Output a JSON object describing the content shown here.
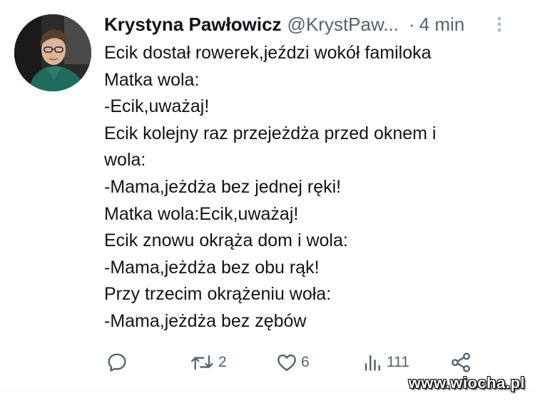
{
  "author": {
    "display_name": "Krystyna Pawłowicz",
    "handle": "@KrystPaw...",
    "separator": "·",
    "time": "4 min"
  },
  "tweet": {
    "lines": [
      "Ecik dostał rowerek,jeździ wokół familoka",
      "Matka wola:",
      "-Ecik,uważaj!",
      "Ecik kolejny raz przejeżdża przed oknem i",
      "wola:",
      "-Mama,jeżdża bez jednej ręki!",
      "Matka wola:Ecik,uważaj!",
      "Ecik znowu okrąża dom i wola:",
      "-Mama,jeżdża bez obu rąk!",
      "Przy trzecim okrążeniu woła:",
      "-Mama,jeżdża bez zębów"
    ]
  },
  "actions": {
    "reply_count": "",
    "retweet_count": "2",
    "like_count": "6",
    "views_count": "111"
  },
  "watermark": "www.wiocha.pl",
  "colors": {
    "text": "#0f1419",
    "muted": "#536471",
    "divider": "#eff3f4"
  },
  "icons": [
    "more-icon",
    "reply-icon",
    "retweet-icon",
    "like-icon",
    "views-icon",
    "share-icon"
  ]
}
